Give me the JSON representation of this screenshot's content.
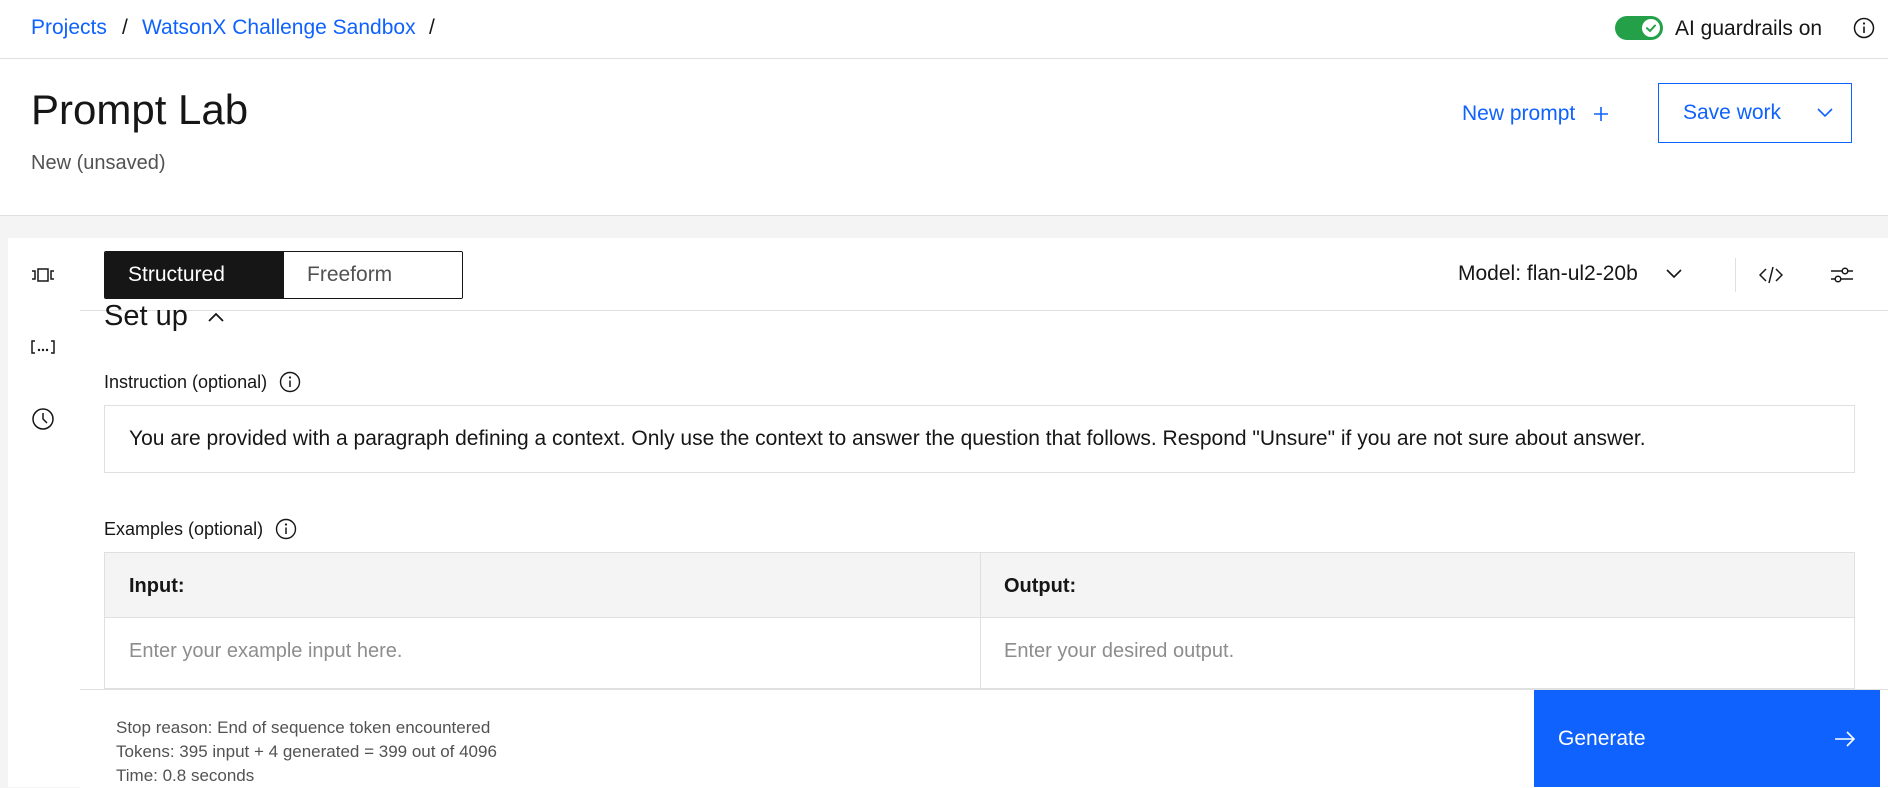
{
  "breadcrumbs": [
    {
      "label": "Projects"
    },
    {
      "label": "WatsonX Challenge Sandbox"
    }
  ],
  "breadcrumb_separator": "/",
  "guardrails": {
    "label": "AI guardrails on",
    "enabled": true
  },
  "header": {
    "title": "Prompt Lab",
    "subtitle": "New (unsaved)",
    "new_prompt_label": "New prompt",
    "save_label": "Save work"
  },
  "mode_switch": {
    "options": [
      "Structured",
      "Freeform"
    ],
    "selected": "Structured"
  },
  "model": {
    "label": "Model: flan-ul2-20b"
  },
  "setup": {
    "title": "Set up",
    "instruction_label": "Instruction (optional)",
    "instruction_value": "You are provided with a paragraph defining a context. Only use the context to answer the question that follows. Respond \"Unsure\" if you are not sure about answer.",
    "examples_label": "Examples (optional)",
    "examples": {
      "columns": [
        "Input:",
        "Output:"
      ],
      "input_placeholder": "Enter your example input here.",
      "output_placeholder": "Enter your desired output."
    }
  },
  "stats": {
    "stop_reason": "Stop reason: End of sequence token encountered",
    "tokens": "Tokens: 395 input + 4 generated = 399 out of 4096",
    "time": "Time: 0.8 seconds"
  },
  "generate_label": "Generate",
  "colors": {
    "accent": "#0f62fe",
    "toggle_on": "#24a148",
    "dark": "#161616"
  },
  "icons": [
    "toggle-check-icon",
    "info-icon",
    "plus-icon",
    "chevron-down-icon",
    "sample-prompts-icon",
    "token-variables-icon",
    "history-icon",
    "code-icon",
    "settings-sliders-icon",
    "chevron-up-icon",
    "arrow-right-icon"
  ]
}
